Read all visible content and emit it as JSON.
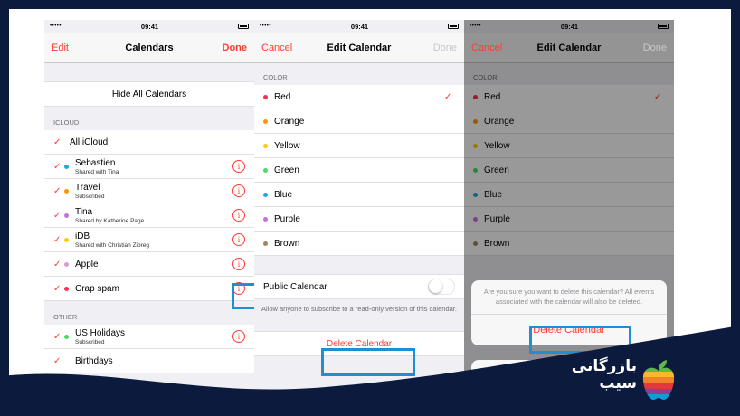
{
  "status": {
    "carrier": "•••••",
    "time": "09:41"
  },
  "screen1": {
    "nav": {
      "left": "Edit",
      "title": "Calendars",
      "right": "Done"
    },
    "hide_all": "Hide All Calendars",
    "icloud_header": "ICLOUD",
    "all_icloud": "All iCloud",
    "calendars": [
      {
        "name": "Sebastien",
        "sub": "Shared with Tina",
        "color": "#1aa7e8"
      },
      {
        "name": "Travel",
        "sub": "Subscribed",
        "color": "#ff9500"
      },
      {
        "name": "Tina",
        "sub": "Shared by Katherine Page",
        "color": "#c86ee0"
      },
      {
        "name": "iDB",
        "sub": "Shared with Christian Zibreg",
        "color": "#ffcc00"
      },
      {
        "name": "Apple",
        "sub": "",
        "color": "#d99ad6"
      },
      {
        "name": "Crap spam",
        "sub": "",
        "color": "#ff2d55"
      }
    ],
    "other_header": "OTHER",
    "other": [
      {
        "name": "US Holidays",
        "sub": "Subscribed",
        "color": "#4cd964"
      },
      {
        "name": "Birthdays",
        "sub": "",
        "color": ""
      }
    ]
  },
  "screen2": {
    "nav": {
      "left": "Cancel",
      "title": "Edit Calendar",
      "right": "Done"
    },
    "color_header": "COLOR",
    "colors": [
      {
        "name": "Red",
        "color": "#ff2d55",
        "selected": true
      },
      {
        "name": "Orange",
        "color": "#ff9500",
        "selected": false
      },
      {
        "name": "Yellow",
        "color": "#ffcc00",
        "selected": false
      },
      {
        "name": "Green",
        "color": "#4cd964",
        "selected": false
      },
      {
        "name": "Blue",
        "color": "#1aa7e8",
        "selected": false
      },
      {
        "name": "Purple",
        "color": "#c86ee0",
        "selected": false
      },
      {
        "name": "Brown",
        "color": "#a2845e",
        "selected": false
      }
    ],
    "public_label": "Public Calendar",
    "public_on": false,
    "public_footer": "Allow anyone to subscribe to a read-only version of this calendar.",
    "delete_label": "Delete Calendar"
  },
  "screen3": {
    "alert_message": "Are you sure you want to delete this calendar? All events associated with the calendar will also be deleted.",
    "delete_action": "Delete Calendar"
  },
  "brand": {
    "line1": "بازرگانی",
    "line2": "سیب"
  },
  "colors": {
    "accent": "#ff3b30",
    "highlight": "#1e8fd6",
    "background": "#0c1a3d"
  }
}
